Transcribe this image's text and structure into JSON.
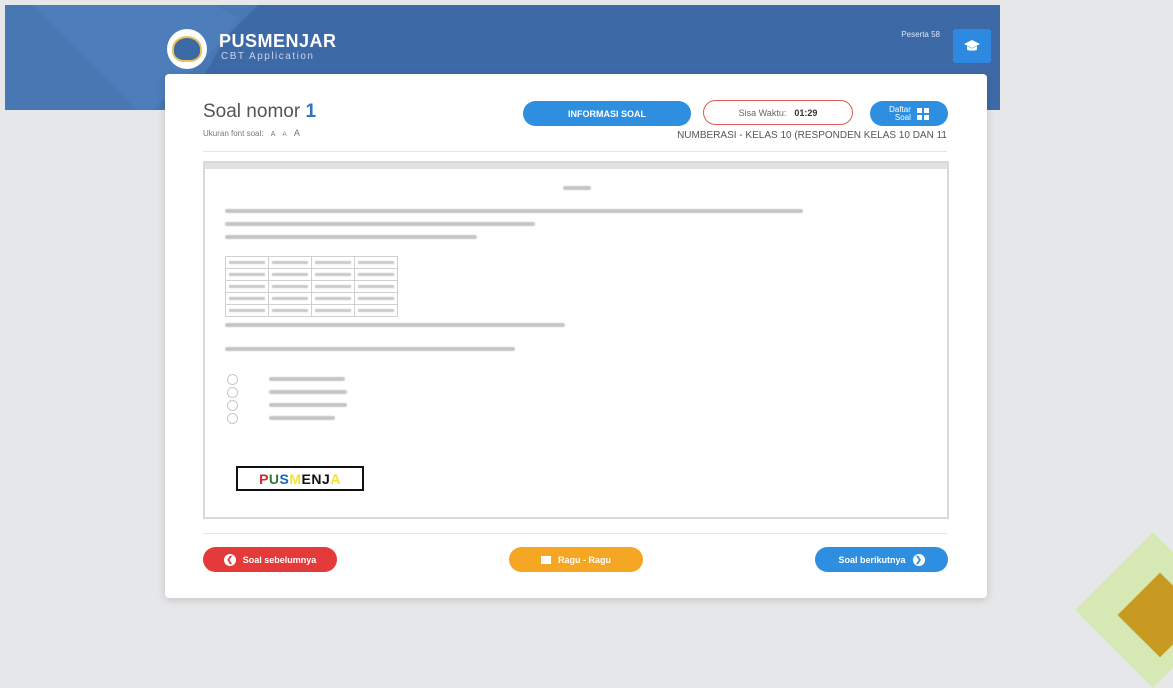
{
  "header": {
    "brand_title": "PUSMENJAR",
    "brand_subtitle": "CBT Application",
    "participant": "Peserta 58",
    "user_icon": "graduation-cap-icon"
  },
  "question": {
    "title_label": "Soal nomor",
    "number": "1",
    "font_size_label": "Ukuran font soal:",
    "font_size_options": [
      "A",
      "A",
      "A"
    ],
    "info_button": "INFORMASI SOAL",
    "timer_label": "Sisa Waktu:",
    "timer_value": "01:29",
    "list_button_line1": "Daftar",
    "list_button_line2": "Soal",
    "category": "NUMBERASI - KELAS 10 (RESPONDEN KELAS 10 DAN 11"
  },
  "watermark": [
    "P",
    "U",
    "S",
    "M",
    "E",
    "N",
    "J",
    "A"
  ],
  "navigation": {
    "prev_label": "Soal sebelumnya",
    "doubt_label": "Ragu - Ragu",
    "next_label": "Soal berikutnya"
  },
  "colors": {
    "header": "#3d6aa6",
    "primary": "#2e8fe0",
    "prev": "#e53a3a",
    "doubt": "#f5a623"
  }
}
